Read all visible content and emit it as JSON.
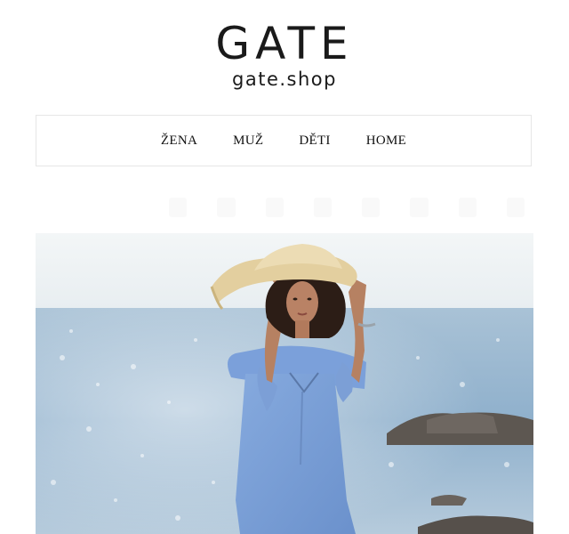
{
  "header": {
    "logo_text": "GATE",
    "domain": "gate.shop"
  },
  "nav": {
    "items": [
      {
        "label": "ŽENA"
      },
      {
        "label": "MUŽ"
      },
      {
        "label": "DĚTI"
      },
      {
        "label": "HOME"
      }
    ]
  },
  "hero": {
    "image_subject": "woman-in-blue-dress-and-straw-hat-by-sea",
    "colors": {
      "sky": "#eef2f4",
      "sea": "#8fb1cf",
      "dress": "#7ea2da",
      "hat": "#e3cf9f",
      "rock": "#5c5650"
    }
  }
}
